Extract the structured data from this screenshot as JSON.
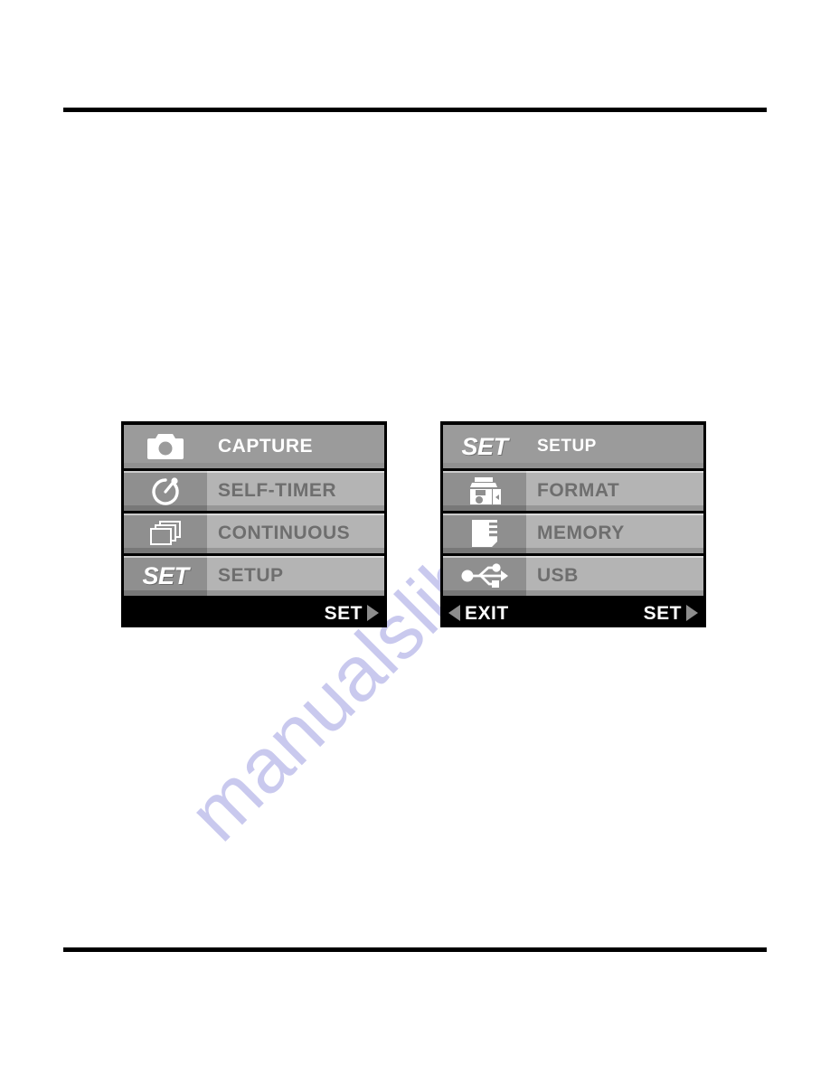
{
  "page": {
    "watermark_text": "manualslib.com"
  },
  "screens": [
    {
      "id": "capture-menu",
      "rows": [
        {
          "icon": "camera-icon",
          "label": "CAPTURE",
          "selected": true
        },
        {
          "icon": "self-timer-icon",
          "label": "SELF-TIMER",
          "selected": false
        },
        {
          "icon": "continuous-icon",
          "label": "CONTINUOUS",
          "selected": false
        },
        {
          "icon": "set-text-icon",
          "label": "SETUP",
          "selected": false
        }
      ],
      "status_bar": {
        "left_label": "",
        "left_arrow": false,
        "right_label": "SET",
        "right_arrow": true
      }
    },
    {
      "id": "setup-menu",
      "rows": [
        {
          "icon": "set-text-icon",
          "label": "SETUP",
          "selected": true
        },
        {
          "icon": "format-icon",
          "label": "FORMAT",
          "selected": false
        },
        {
          "icon": "memory-icon",
          "label": "MEMORY",
          "selected": false
        },
        {
          "icon": "usb-icon",
          "label": "USB",
          "selected": false
        }
      ],
      "status_bar": {
        "left_label": "EXIT",
        "left_arrow": true,
        "right_label": "SET",
        "right_arrow": true
      }
    }
  ],
  "colors": {
    "screen_border": "#000000",
    "row_selected_bg": "#9b9b9b",
    "row_icon_bg": "#8f8f8f",
    "row_label_bg": "#b4b4b4",
    "row_label_text": "#6e6e6e",
    "selected_text": "#ffffff",
    "status_bar_bg": "#000000",
    "arrow_color": "#8d8d8d",
    "rule_color": "#000000",
    "watermark_color": "#c9c9ee"
  }
}
